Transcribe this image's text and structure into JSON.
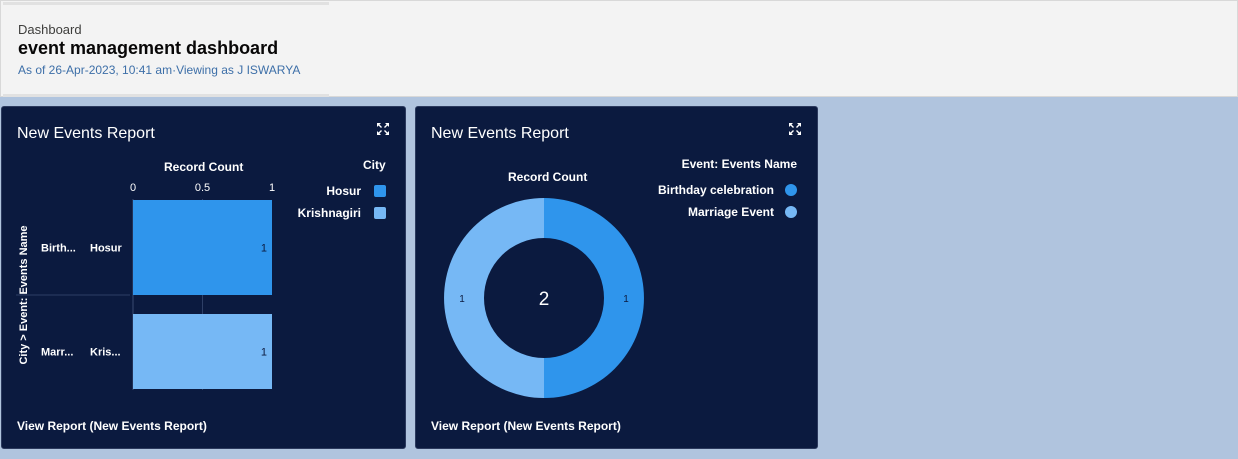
{
  "header": {
    "eyebrow": "Dashboard",
    "title": "event management dashboard",
    "meta": "As of 26-Apr-2023, 10:41 am·Viewing as J ISWARYA"
  },
  "colors": {
    "page_bg": "#b0c4de",
    "card_bg": "#0b1a3f",
    "series_dark": "#2f95ec",
    "series_light": "#76b8f5"
  },
  "cards": [
    {
      "title": "New Events Report",
      "footer": "View Report (New Events Report)",
      "expand_icon": "expand-icon",
      "legend_title": "City",
      "legend_items": [
        "Hosur",
        "Krishnagiri"
      ],
      "x_axis_title": "Record Count",
      "y_axis_title": "City > Event: Events Name",
      "row_labels": [
        {
          "event": "Birth...",
          "city": "Hosur"
        },
        {
          "event": "Marr...",
          "city": "Kris..."
        }
      ]
    },
    {
      "title": "New Events Report",
      "footer": "View Report (New Events Report)",
      "expand_icon": "expand-icon",
      "legend_title": "Event: Events Name",
      "legend_items": [
        "Birthday celebration",
        "Marriage Event"
      ],
      "measure_title": "Record Count",
      "center_total": "2"
    }
  ],
  "chart_data": [
    {
      "type": "bar",
      "orientation": "horizontal",
      "title": "New Events Report",
      "xlabel": "Record Count",
      "ylabel": "City > Event: Events Name",
      "xlim": [
        0,
        1
      ],
      "xticks": [
        "0",
        "0.5",
        "1"
      ],
      "categories": [
        "Birth... / Hosur",
        "Marr... / Kris..."
      ],
      "series": [
        {
          "name": "Hosur",
          "values": [
            1,
            0
          ],
          "color": "#2f95ec"
        },
        {
          "name": "Krishnagiri",
          "values": [
            0,
            1
          ],
          "color": "#76b8f5"
        }
      ],
      "data_labels": [
        "1",
        "1"
      ],
      "legend_position": "right"
    },
    {
      "type": "pie",
      "variant": "donut",
      "title": "New Events Report",
      "measure": "Record Count",
      "categories": [
        "Birthday celebration",
        "Marriage Event"
      ],
      "values": [
        1,
        1
      ],
      "colors": [
        "#2f95ec",
        "#76b8f5"
      ],
      "total": 2,
      "legend_position": "right"
    }
  ]
}
